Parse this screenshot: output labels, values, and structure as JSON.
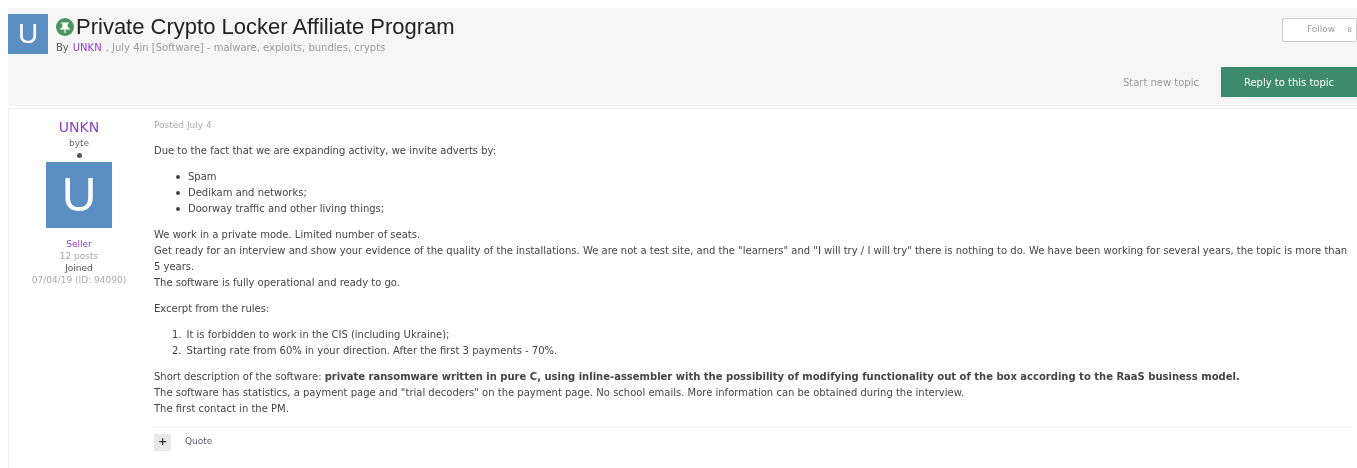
{
  "topic": {
    "avatar_letter": "U",
    "title": "Private Crypto Locker Affiliate Program",
    "by": "By",
    "author": "UNKN",
    "meta": ", July 4in [Software] - malware, exploits, bundles, crypts",
    "follow": {
      "label": "Follow",
      "count": "8"
    },
    "start_new_topic": "Start new topic",
    "reply": "Reply to this topic"
  },
  "author_panel": {
    "name": "UNKN",
    "rank": "byte",
    "avatar_letter": "U",
    "group": "Seller",
    "posts": "12 posts",
    "joined_label": "Joined",
    "joined": "07/04/19 (ID: 94090)"
  },
  "post": {
    "posted": "Posted July 4",
    "blocks": [
      {
        "kind": "paragraph",
        "lines": [
          "Due to the fact that we are expanding activity, we invite adverts by:"
        ]
      },
      {
        "kind": "bullets",
        "items": [
          "Spam",
          "Dedikam and networks;",
          "Doorway traffic and other living things;"
        ]
      },
      {
        "kind": "paragraph",
        "lines": [
          "We work in a private mode. Limited number of seats.",
          "Get ready for an interview and show your evidence of the quality of the installations. We are not a test site, and the \"learners\" and \"I will try / I will try\" there is nothing to do. We have been working for several years, the topic is more than 5 years.",
          "The software is fully operational and ready to go."
        ]
      },
      {
        "kind": "paragraph",
        "lines": [
          "Excerpt from the rules:"
        ]
      },
      {
        "kind": "numbered",
        "items": [
          {
            "marker": "1.",
            "text": "It is forbidden to work in the CIS (including Ukraine);"
          },
          {
            "marker": "2.",
            "text": "Starting rate from 60% in your direction. After the first 3 payments - 70%."
          }
        ]
      },
      {
        "kind": "paragraph",
        "lines": [
          "Short description of the software: **private ransomware written in pure C, using inline-assembler with the possibility of modifying functionality out of the box according to the RaaS business model.**",
          "The software has statistics, a payment page and \"trial decoders\" on the payment page. No school emails. More information can be obtained during the interview.",
          "The first contact in the PM."
        ]
      }
    ],
    "plus": "+",
    "quote": "Quote"
  }
}
